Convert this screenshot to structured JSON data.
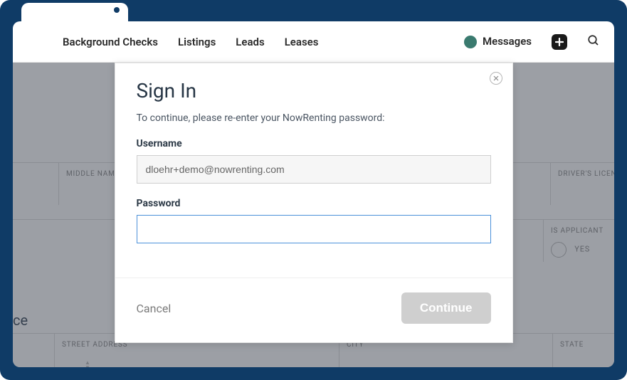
{
  "nav": {
    "items": [
      "Background Checks",
      "Listings",
      "Leads",
      "Leases"
    ],
    "messages_label": "Messages"
  },
  "bg": {
    "middle_name_label": "MIDDLE NAME",
    "drivers_label": "DRIVER'S LICEN",
    "is_applicant_label": "IS APPLICANT",
    "yes_label": "YES",
    "heading_suffix": "ce",
    "street_label": "STREET ADDRESS",
    "city_label": "CITY",
    "state_label": "STATE"
  },
  "modal": {
    "title": "Sign In",
    "subtitle": "To continue, please re-enter your NowRenting password:",
    "username_label": "Username",
    "username_value": "dloehr+demo@nowrenting.com",
    "password_label": "Password",
    "password_value": "",
    "cancel_label": "Cancel",
    "continue_label": "Continue"
  }
}
